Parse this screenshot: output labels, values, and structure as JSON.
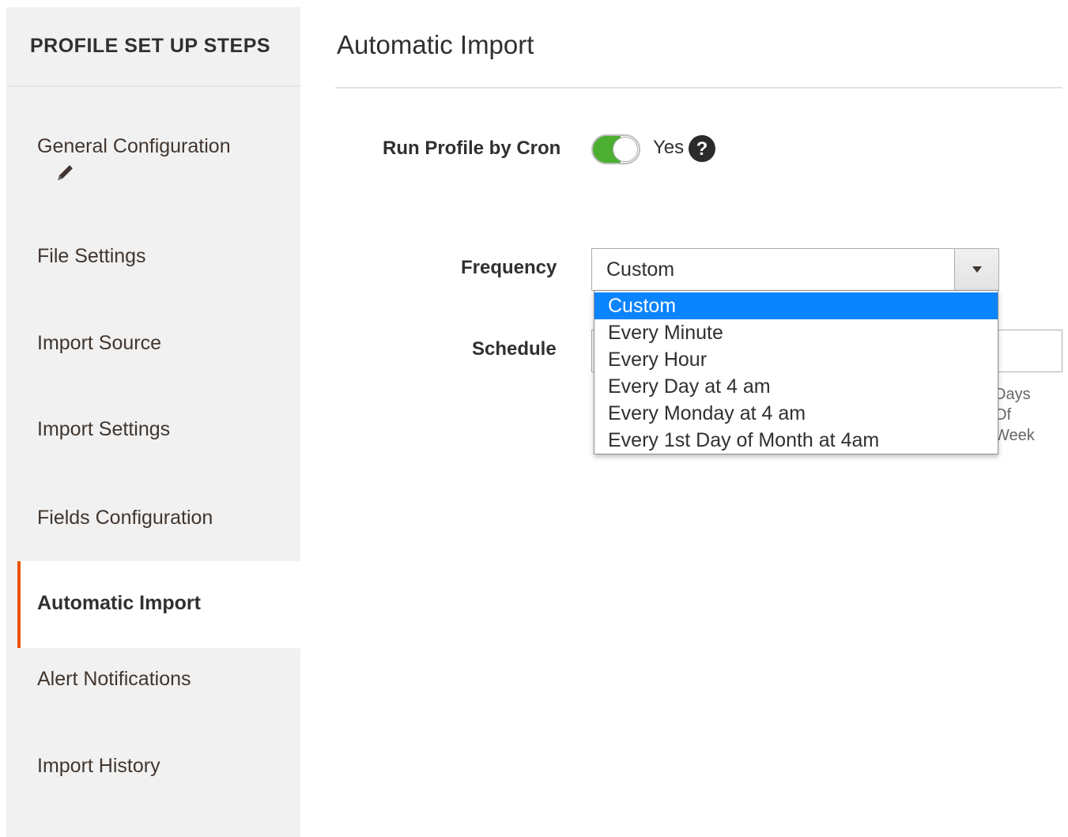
{
  "sidebar": {
    "title": "PROFILE SET UP STEPS",
    "items": [
      {
        "label": "General Configuration"
      },
      {
        "label": "File Settings"
      },
      {
        "label": "Import Source"
      },
      {
        "label": "Import Settings"
      },
      {
        "label": "Fields Configuration"
      },
      {
        "label": "Automatic Import"
      },
      {
        "label": "Alert Notifications"
      },
      {
        "label": "Import History"
      }
    ],
    "active_item": "Automatic Import"
  },
  "main": {
    "title": "Automatic Import",
    "run_profile_by_cron": {
      "label": "Run Profile by Cron",
      "toggle_state": "on",
      "value_text": "Yes"
    },
    "frequency": {
      "label": "Frequency",
      "selected": "Custom",
      "options": [
        "Custom",
        "Every Minute",
        "Every Hour",
        "Every Day at 4 am",
        "Every Monday at 4 am",
        "Every 1st Day of Month at 4am"
      ]
    },
    "schedule": {
      "label": "Schedule",
      "hint_lines": [
        "Days",
        "Of",
        "Week"
      ]
    }
  },
  "colors": {
    "accent": "#eb5202",
    "toggle_on": "#4caf32",
    "option_highlight": "#0a84ff"
  }
}
